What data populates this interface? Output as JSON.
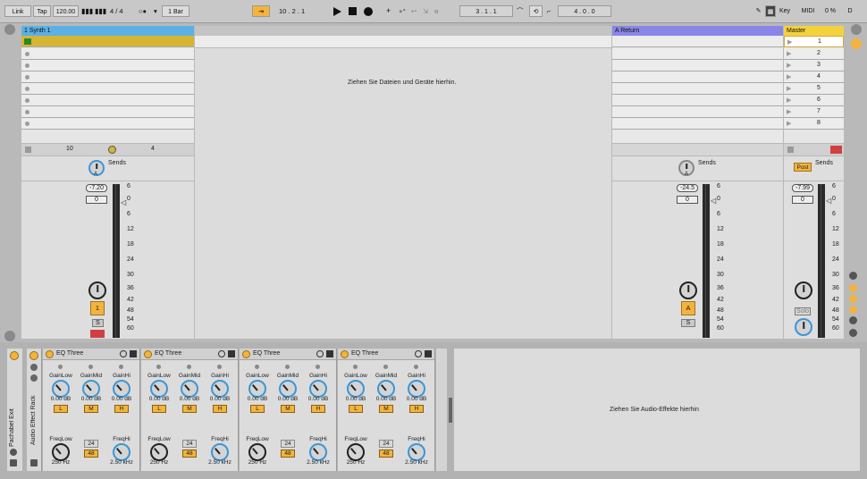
{
  "transport": {
    "link": "Link",
    "tap": "Tap",
    "tempo": "120.00",
    "signature": "4 / 4",
    "metro_mode": "○●",
    "quantize": "1 Bar",
    "arrangement_position": "10 .  2 .  1",
    "loop_start": "3 .  1 .  1",
    "loop_length": "4 .  0 .  0",
    "key": "Key",
    "midi": "MIDI",
    "cpu": "0 %",
    "disk": "D"
  },
  "tracks": {
    "synth": {
      "name": "1 Synth 1",
      "color": "#5bb0e6",
      "volume": "-7.20",
      "pan": "0",
      "track_number": "1",
      "solo": "S",
      "stop_count": "10",
      "stop_value": "4",
      "sends_label": "Sends",
      "send_letter": "A"
    },
    "return": {
      "name": "A Return",
      "color": "#8a86e8",
      "volume": "-24.5",
      "pan": "0",
      "track_letter": "A",
      "solo": "S",
      "sends_label": "Sends",
      "send_letter": "A"
    },
    "master": {
      "name": "Master",
      "color": "#f4d23c",
      "volume": "-7.99",
      "pan": "0",
      "post": "Post",
      "sends_label": "Sends",
      "solo": "Solo",
      "scenes": [
        "1",
        "2",
        "3",
        "4",
        "5",
        "6",
        "7",
        "8"
      ]
    }
  },
  "drop_hint_session": "Ziehen Sie Dateien und Geräte hierhin.",
  "drop_hint_devices": "Ziehen Sie Audio-Effekte hierhin",
  "meter_scale": [
    "6",
    "0",
    "6",
    "12",
    "18",
    "24",
    "30",
    "36",
    "42",
    "48",
    "54",
    "60"
  ],
  "rack": {
    "name": "Audio Effect Rack",
    "track_label": "Pachabel Exit"
  },
  "eq_devices": [
    {
      "title": "EQ Three",
      "gainlow": "GainLow",
      "gainmid": "GainMid",
      "gainhi": "GainHi",
      "v1": "0.00 dB",
      "v2": "0.00 dB",
      "v3": "0.00 dB",
      "l": "L",
      "m": "M",
      "h": "H",
      "freqlow": "FreqLow",
      "freqhi": "FreqHi",
      "fl": "250 Hz",
      "fh": "2.50 kHz",
      "s1": "24",
      "s2": "48"
    },
    {
      "title": "EQ Three",
      "gainlow": "GainLow",
      "gainmid": "GainMid",
      "gainhi": "GainHi",
      "v1": "0.00 dB",
      "v2": "0.00 dB",
      "v3": "0.00 dB",
      "l": "L",
      "m": "M",
      "h": "H",
      "freqlow": "FreqLow",
      "freqhi": "FreqHi",
      "fl": "250 Hz",
      "fh": "2.50 kHz",
      "s1": "24",
      "s2": "48"
    },
    {
      "title": "EQ Three",
      "gainlow": "GainLow",
      "gainmid": "GainMid",
      "gainhi": "GainHi",
      "v1": "0.00 dB",
      "v2": "0.00 dB",
      "v3": "0.00 dB",
      "l": "L",
      "m": "M",
      "h": "H",
      "freqlow": "FreqLow",
      "freqhi": "FreqHi",
      "fl": "250 Hz",
      "fh": "2.50 kHz",
      "s1": "24",
      "s2": "48"
    },
    {
      "title": "EQ Three",
      "gainlow": "GainLow",
      "gainmid": "GainMid",
      "gainhi": "GainHi",
      "v1": "0.00 dB",
      "v2": "0.00 dB",
      "v3": "0.00 dB",
      "l": "L",
      "m": "M",
      "h": "H",
      "freqlow": "FreqLow",
      "freqhi": "FreqHi",
      "fl": "250 Hz",
      "fh": "2.50 kHz",
      "s1": "24",
      "s2": "48"
    }
  ],
  "colors": {
    "accent": "#f3b43d",
    "knob": "#3c96d8",
    "clip": "#d6b535"
  }
}
